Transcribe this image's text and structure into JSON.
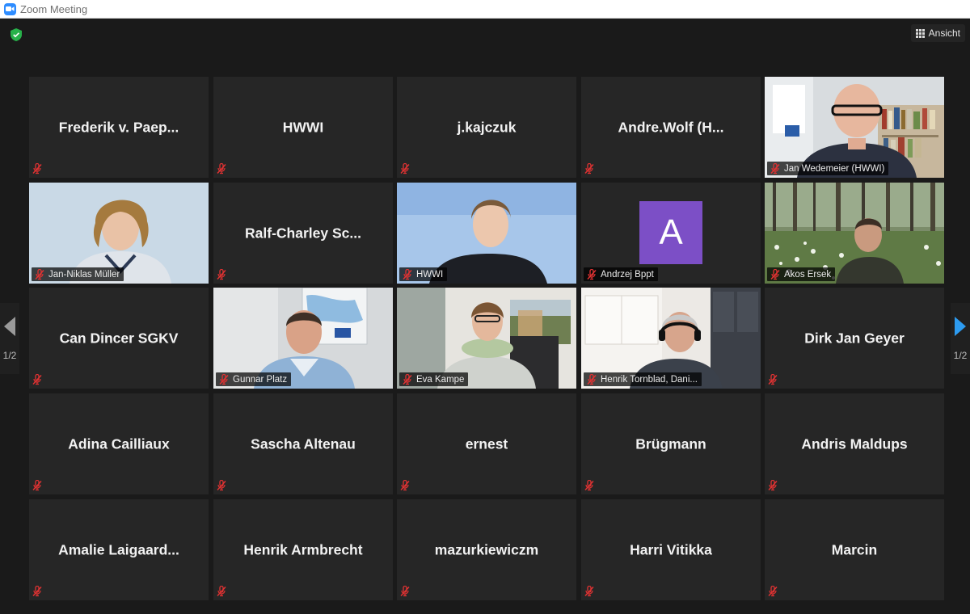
{
  "window": {
    "title": "Zoom Meeting"
  },
  "toolbar": {
    "view_label": "Ansicht"
  },
  "pager": {
    "left_page": "1/2",
    "right_page": "1/2"
  },
  "colors": {
    "active_speaker": "#c9e25e",
    "mute_red": "#e03232",
    "shield_green": "#27b14a",
    "avatar_purple": "#7c4fc6",
    "zoom_blue": "#2d8cff"
  },
  "participants": [
    {
      "name": "Frederik  v.  Paep...",
      "video": false,
      "label": ""
    },
    {
      "name": "HWWI",
      "video": false,
      "label": ""
    },
    {
      "name": "j.kajczuk",
      "video": false,
      "label": ""
    },
    {
      "name": "Andre.Wolf  (H...",
      "video": false,
      "label": ""
    },
    {
      "name": "",
      "video": true,
      "label": "Jan Wedemeier (HWWI)",
      "active": true
    },
    {
      "name": "",
      "video": true,
      "label": "Jan-Niklas Müller"
    },
    {
      "name": "Ralf-Charley  Sc...",
      "video": false,
      "label": ""
    },
    {
      "name": "",
      "video": true,
      "label": "HWWI"
    },
    {
      "name": "",
      "video": false,
      "avatar_letter": "A",
      "label": "Andrzej Bppt"
    },
    {
      "name": "",
      "video": true,
      "label": "Akos Ersek"
    },
    {
      "name": "Can Dincer SGKV",
      "video": false,
      "label": ""
    },
    {
      "name": "",
      "video": true,
      "label": "Gunnar Platz"
    },
    {
      "name": "",
      "video": true,
      "label": "Eva Kampe"
    },
    {
      "name": "",
      "video": true,
      "label": "Henrik Tornblad, Dani..."
    },
    {
      "name": "Dirk Jan Geyer",
      "video": false,
      "label": ""
    },
    {
      "name": "Adina Cailliaux",
      "video": false,
      "label": ""
    },
    {
      "name": "Sascha Altenau",
      "video": false,
      "label": ""
    },
    {
      "name": "ernest",
      "video": false,
      "label": ""
    },
    {
      "name": "Brügmann",
      "video": false,
      "label": ""
    },
    {
      "name": "Andris Maldups",
      "video": false,
      "label": ""
    },
    {
      "name": "Amalie  Laigaard...",
      "video": false,
      "label": ""
    },
    {
      "name": "Henrik Armbrecht",
      "video": false,
      "label": ""
    },
    {
      "name": "mazurkiewiczm",
      "video": false,
      "label": ""
    },
    {
      "name": "Harri Vitikka",
      "video": false,
      "label": ""
    },
    {
      "name": "Marcin",
      "video": false,
      "label": ""
    }
  ]
}
